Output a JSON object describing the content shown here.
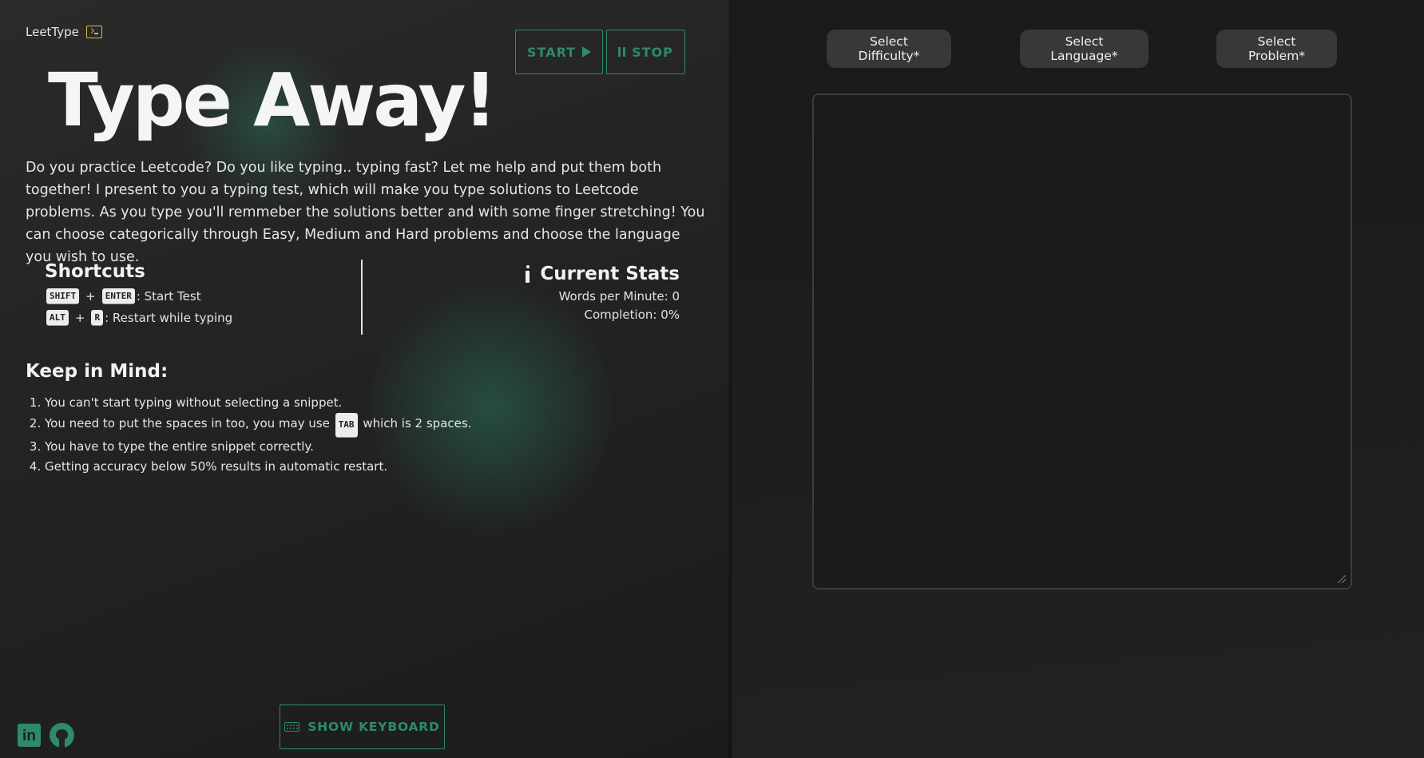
{
  "app": {
    "name": "LeetType"
  },
  "controls": {
    "start_label": "START",
    "stop_label": "STOP"
  },
  "hero": {
    "title": "Type Away!"
  },
  "description": "Do you practice Leetcode? Do you like typing.. typing fast? Let me help and put them both together! I present to you a typing test, which will make you type solutions to Leetcode problems. As you type you'll remmeber the solutions better and with some finger stretching! You can choose categorically through Easy, Medium and Hard problems and choose the language you wish to use.",
  "shortcuts": {
    "title": "Shortcuts",
    "items": [
      {
        "keys": [
          "SHIFT",
          "ENTER"
        ],
        "action": ": Start Test"
      },
      {
        "keys": [
          "ALT",
          "R"
        ],
        "action": ": Restart while typing"
      }
    ]
  },
  "stats": {
    "title": "Current Stats",
    "wpm": "Words per Minute: 0",
    "completion": "Completion: 0%"
  },
  "keep_in_mind": {
    "title": "Keep in Mind:",
    "items": [
      "You can't start typing without selecting a snippet.",
      {
        "before": "You need to put the spaces in too, you may use",
        "key": "TAB",
        "after": "which is 2 spaces."
      },
      "You have to type the entire snippet correctly.",
      "Getting accuracy below 50% results in automatic restart."
    ]
  },
  "keyboard_toggle": {
    "label": "SHOW KEYBOARD"
  },
  "social": {
    "icons": [
      "linkedin-icon",
      "github-icon"
    ]
  },
  "selectors": {
    "difficulty": "Select Difficulty*",
    "language": "Select Language*",
    "problem": "Select Problem*"
  },
  "editor": {
    "value": ""
  },
  "colors": {
    "accent": "#2e8a68",
    "logo_icon": "#e3b341",
    "left_bg": "#262626",
    "right_bg": "#1c1c1c",
    "select_bg": "#383838"
  }
}
